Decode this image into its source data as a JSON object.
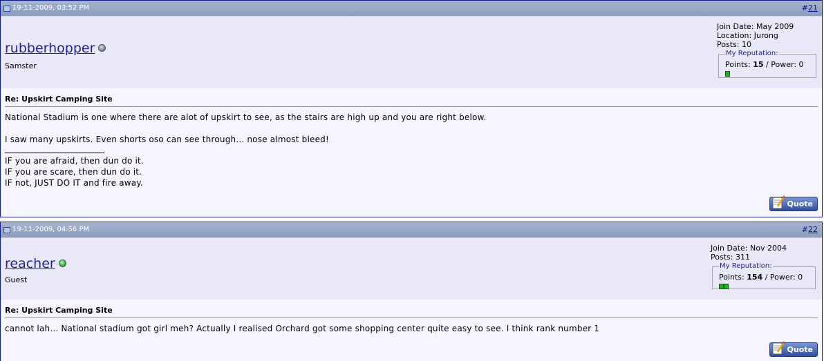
{
  "posts": [
    {
      "date": "19-11-2009, 03:52 PM",
      "number_prefix": "#",
      "number": "21",
      "username": "rubberhopper",
      "user_title": "Samster",
      "join_date": "Join Date: May 2009",
      "location": "Location: Jurong",
      "posts": "Posts: 10",
      "reputation_legend": "My Reputation:",
      "points_label": "Points: ",
      "points": "15",
      "power_text": " / Power: 0",
      "message_title": "Re: Upskirt Camping Site",
      "message_lines": [
        "National Stadium is one where there are alot of upskirt to see, as the stairs are high up and you are right below.",
        "",
        "I saw many upskirts. Even shorts oso can see through... nose almost bleed!"
      ],
      "signature_lines": [
        "IF you are afraid, then dun do it.",
        "IF you are scare, then dun do it.",
        "IF not, JUST DO IT and fire away."
      ],
      "quote_label": "Quote"
    },
    {
      "date": "19-11-2009, 04:56 PM",
      "number_prefix": "#",
      "number": "22",
      "username": "reacher",
      "user_title": "Guest",
      "join_date": "Join Date: Nov 2004",
      "posts": "Posts: 311",
      "reputation_legend": "My Reputation:",
      "points_label": "Points: ",
      "points": "154",
      "power_text": " / Power: 0",
      "message_title": "Re: Upskirt Camping Site",
      "message_lines": [
        "cannot lah... National stadium got girl meh? Actually I realised Orchard got some shopping center quite easy to see. I think rank number 1"
      ],
      "quote_label": "Quote"
    }
  ],
  "icons": {
    "post_icon": "post-icon",
    "status_offline": "user-offline-icon",
    "status_online": "user-online-icon",
    "reputation_pip": "reputation-pip-icon",
    "quote_icon": "quote-icon"
  },
  "colors": {
    "header_bar": "#8c9dbe",
    "username": "#22229c",
    "online": "#2fb82f",
    "offline": "#7a88ac"
  }
}
